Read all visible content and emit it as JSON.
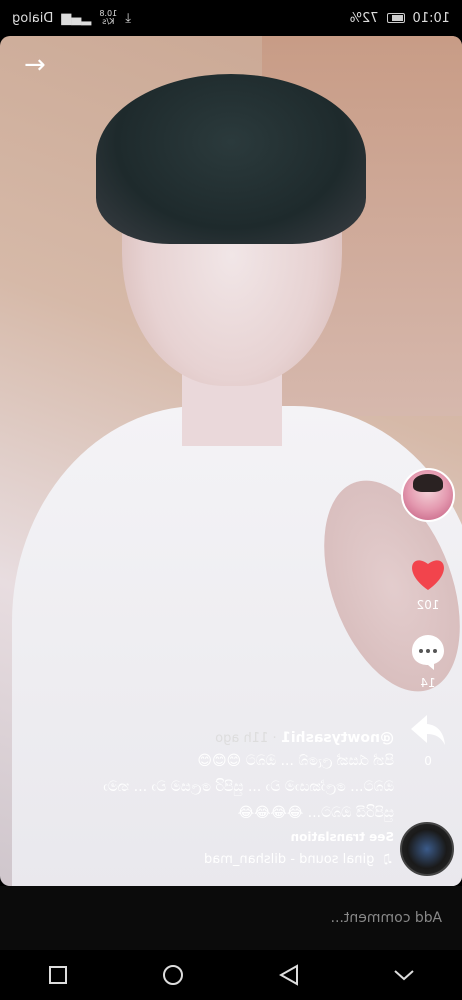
{
  "status_bar": {
    "time": "10:10",
    "battery": "72%",
    "carrier": "Dialog",
    "net_speed_value": "10.8",
    "net_speed_unit": "K/s",
    "battery_level": 0.72
  },
  "video": {
    "back_icon": "arrow-right-icon",
    "avatar_icon": "profile-avatar"
  },
  "actions": {
    "like_count": "102",
    "comment_count": "14",
    "share_count": "0"
  },
  "caption": {
    "username": "@nowtysashi1",
    "time_ago": "11h ago",
    "line1": "පින් රැසක් ‌ලැබේ ... ඔබට 😊😊😊",
    "line2": "ඔබට... ‍ලෝකයාම වා ... සුපිරි ලෙසම වා ... තමා",
    "line3": "සුපිරියි ඔබට... 😂😂😂😂",
    "see_translation": "See translation",
    "sound": "ginal sound - dilshan_mad"
  },
  "comment_bar": {
    "placeholder": "Add comment..."
  },
  "colors": {
    "like": "#f2444c",
    "background": "#000000"
  }
}
